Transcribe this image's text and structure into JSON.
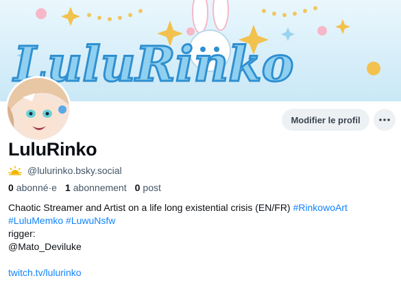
{
  "banner": {
    "logo_text": "LuluRinko",
    "colors": {
      "sky": "#d6eef8",
      "logo_fill": "#8fd0f0",
      "logo_outline": "#2f8fd0",
      "accent": "#f2c14e",
      "pink": "#f6b8c8"
    }
  },
  "profile": {
    "display_name": "LuluRinko",
    "handle": "@lulurinko.bsky.social",
    "handle_icon": "sun-weather-icon"
  },
  "actions": {
    "edit_label": "Modifier le profil",
    "more_icon": "more-horizontal-icon"
  },
  "stats": {
    "followers_count": "0",
    "followers_label": "abonné·e",
    "following_count": "1",
    "following_label": "abonnement",
    "posts_count": "0",
    "posts_label": "post"
  },
  "bio": {
    "line1_text": "Chaotic Streamer and Artist on a life long existential crisis (EN/FR) ",
    "line1_tag": "#RinkowoArt",
    "line2_tag1": "#LuluMemko",
    "line2_tag2": "#LuwuNsfw",
    "line3": "rigger:",
    "line4": "@Mato_Deviluke",
    "link": "twitch.tv/lulurinko"
  }
}
